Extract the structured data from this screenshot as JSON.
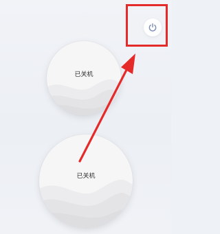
{
  "devices": [
    {
      "status_label": "已关机"
    },
    {
      "status_label": "已关机"
    }
  ],
  "power_button": {
    "icon": "power-icon"
  },
  "colors": {
    "annotation_red": "#e52a2a",
    "power_icon": "#7b8eb8",
    "background": "#eef1f5"
  }
}
